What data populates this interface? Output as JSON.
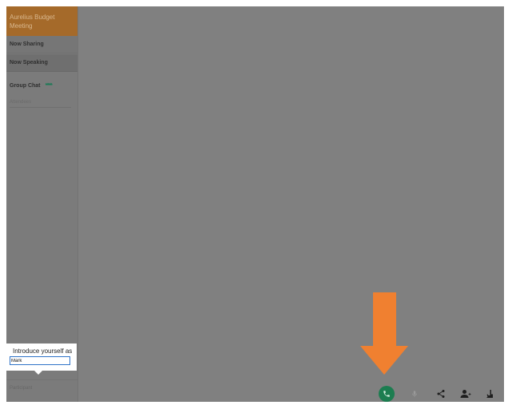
{
  "sidebar": {
    "meeting_title": "Aurelius Budget Meeting",
    "now_sharing": "Now Sharing",
    "now_speaking": "Now Speaking",
    "group_chat": "Group Chat",
    "chat_icon": "chat-bubbles-icon",
    "attendees": "Attendees",
    "participant": "Participant"
  },
  "popup": {
    "label": "Introduce yourself as",
    "name_value": "Mark"
  },
  "toolbar": {
    "icons": [
      "phone-icon",
      "microphone-icon",
      "share-icon",
      "add-person-icon",
      "raise-hand-icon"
    ]
  },
  "colors": {
    "overlay_gray": "#808080",
    "meeting_title_bg": "#a56a2a",
    "call_green": "#1c7d50",
    "arrow_orange": "#f08030"
  }
}
